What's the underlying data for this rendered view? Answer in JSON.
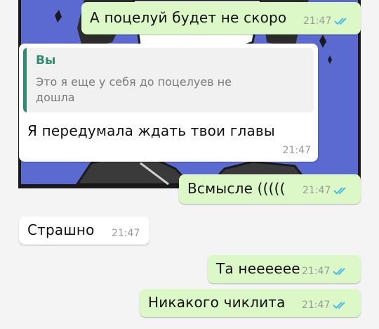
{
  "chat": {
    "messages": [
      {
        "direction": "out",
        "text": "А поцелуй будет не скоро",
        "time": "21:47",
        "status": "read"
      },
      {
        "direction": "in",
        "reply": {
          "author": "Вы",
          "text": "Это я еще у себя до поцелуев не дошла"
        },
        "text": "Я передумала ждать твои главы",
        "time": "21:47"
      },
      {
        "direction": "out",
        "text": "Всмысле (((((",
        "time": "21:47",
        "status": "read"
      },
      {
        "direction": "in",
        "text": "Страшно",
        "time": "21:47"
      },
      {
        "direction": "out",
        "text": "Та нееееее",
        "time": "21:47",
        "status": "read"
      },
      {
        "direction": "out",
        "text": "Никакого чиклита",
        "time": "21:47",
        "status": "read"
      }
    ]
  },
  "colors": {
    "outgoing_bubble": "#dcf8c6",
    "incoming_bubble": "#ffffff",
    "read_ticks": "#34b7f1",
    "reply_accent": "#2e8b6f",
    "wallpaper_blue": "#5b6ad0"
  },
  "icons": {
    "read_status": "double-check-icon"
  }
}
